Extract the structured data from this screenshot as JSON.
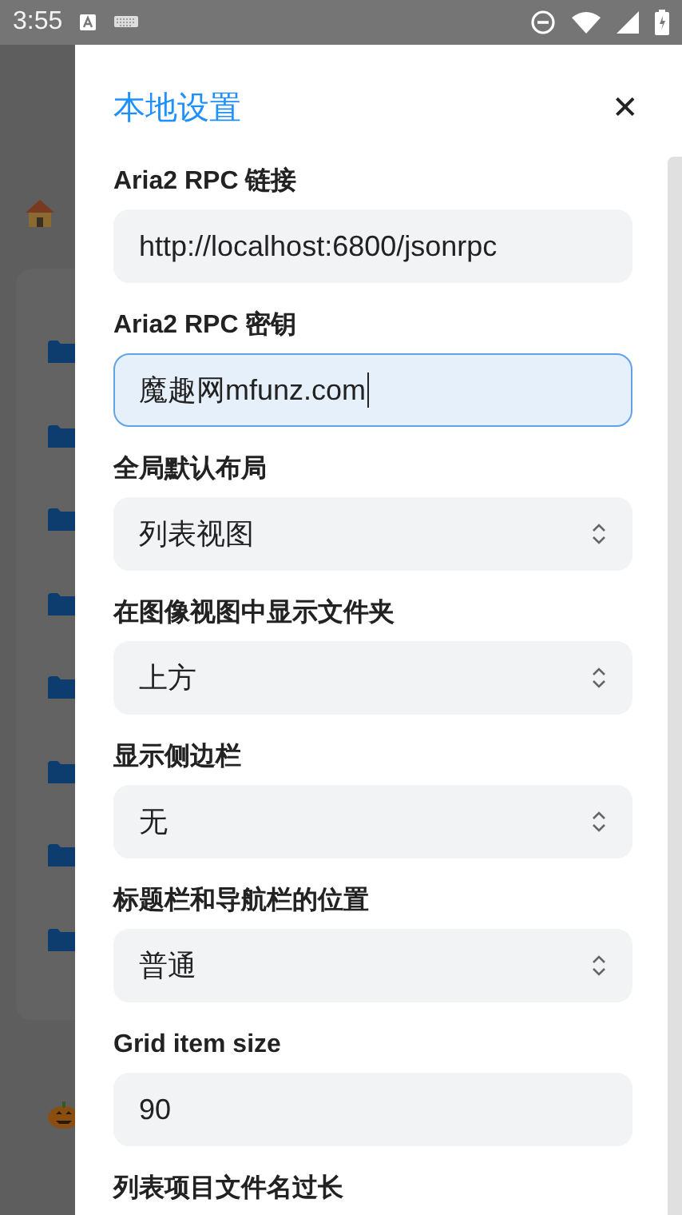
{
  "status_bar": {
    "time": "3:55"
  },
  "drawer": {
    "title": "本地设置",
    "close": "✕",
    "fields": [
      {
        "label": "Aria2 RPC 链接",
        "kind": "text",
        "value": "http://localhost:6800/jsonrpc",
        "focused": false
      },
      {
        "label": "Aria2 RPC 密钥",
        "kind": "text",
        "value": "魔趣网mfunz.com",
        "focused": true
      },
      {
        "label": "全局默认布局",
        "kind": "select",
        "value": "列表视图",
        "focused": false
      },
      {
        "label": "在图像视图中显示文件夹",
        "kind": "select",
        "value": "上方",
        "focused": false
      },
      {
        "label": "显示侧边栏",
        "kind": "select",
        "value": "无",
        "focused": false
      },
      {
        "label": "标题栏和导航栏的位置",
        "kind": "select",
        "value": "普通",
        "focused": false
      },
      {
        "label": "Grid item size",
        "kind": "text",
        "value": "90",
        "focused": false
      },
      {
        "label": "列表项目文件名过长",
        "kind": "none"
      }
    ]
  }
}
